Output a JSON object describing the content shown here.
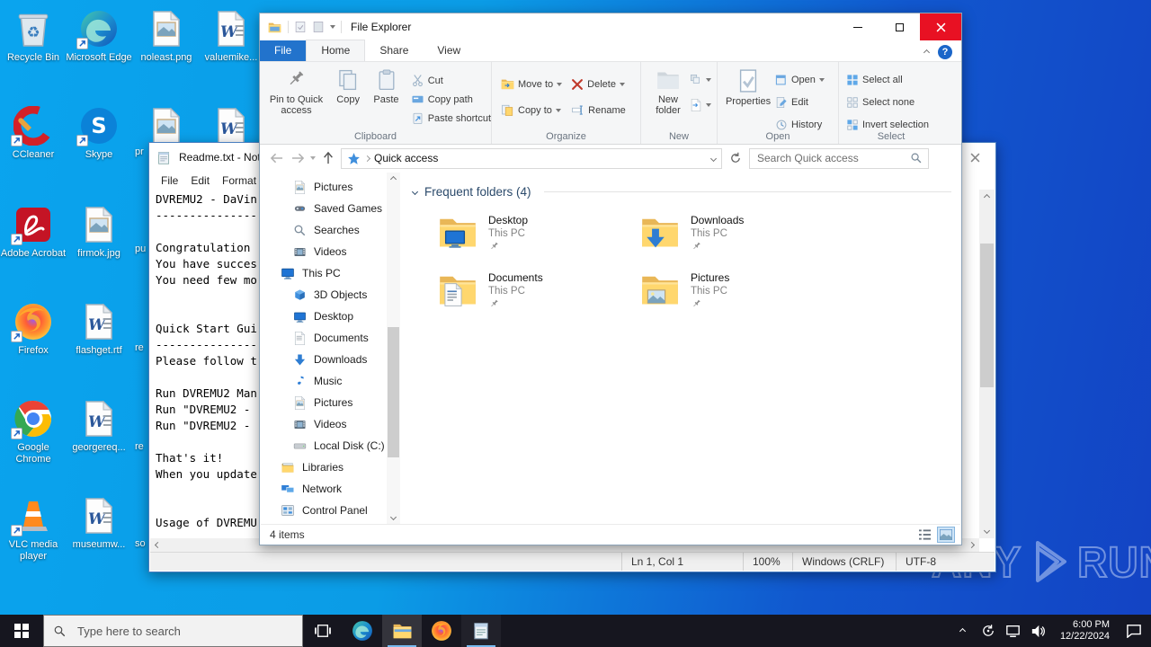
{
  "colors": {
    "accent_blue": "#2273cc",
    "close_button_red": "#e81123",
    "desktop_gradient_left": "#0aa4ee",
    "desktop_gradient_right": "#1343c4",
    "folder_yellow": "#ffd76e",
    "taskbar_bg": "#16161f",
    "taskbar_active_underline": "#76b9ed"
  },
  "desktop": {
    "icons": [
      {
        "label": "Recycle Bin"
      },
      {
        "label": "Microsoft Edge"
      },
      {
        "label": "noleast.png"
      },
      {
        "label": "valuemike..."
      },
      {
        "label": "CCleaner"
      },
      {
        "label": "Skype"
      },
      {
        "label": "pr"
      },
      {
        "label": "Adobe Acrobat"
      },
      {
        "label": "firmok.jpg"
      },
      {
        "label": "pu"
      },
      {
        "label": "Firefox"
      },
      {
        "label": "flashget.rtf"
      },
      {
        "label": "re"
      },
      {
        "label": "Google Chrome"
      },
      {
        "label": "georgereq..."
      },
      {
        "label": "re"
      },
      {
        "label": "VLC media player"
      },
      {
        "label": "museumw..."
      },
      {
        "label": "so"
      }
    ]
  },
  "watermark": {
    "left": "ANY",
    "right": "RUN"
  },
  "notepad": {
    "title": "Readme.txt - Notepad",
    "menu": [
      "File",
      "Edit",
      "Format"
    ],
    "text": "DVREMU2 - DaVin\n----------------\n\nCongratulation\nYou have succes\nYou need few mo\n\n\nQuick Start Gui\n----------------\nPlease follow t\n\nRun DVREMU2 Man\nRun \"DVREMU2 -\nRun \"DVREMU2 -\n\nThat's it!\nWhen you update\n\n\nUsage of DVREMU\n----------------",
    "status": {
      "cursor": "Ln 1, Col 1",
      "zoom": "100%",
      "line_ending": "Windows (CRLF)",
      "encoding": "UTF-8"
    }
  },
  "explorer": {
    "window_title": "File Explorer",
    "tabs": {
      "file": "File",
      "home": "Home",
      "share": "Share",
      "view": "View"
    },
    "ribbon": {
      "pin_to_quick_access": "Pin to Quick access",
      "copy": "Copy",
      "paste": "Paste",
      "cut": "Cut",
      "copy_path": "Copy path",
      "paste_shortcut": "Paste shortcut",
      "group_clipboard": "Clipboard",
      "move_to": "Move to",
      "copy_to": "Copy to",
      "delete": "Delete",
      "rename": "Rename",
      "group_organize": "Organize",
      "new_folder": "New folder",
      "group_new": "New",
      "properties": "Properties",
      "open": "Open",
      "edit": "Edit",
      "history": "History",
      "group_open": "Open",
      "select_all": "Select all",
      "select_none": "Select none",
      "invert_selection": "Invert selection",
      "group_select": "Select"
    },
    "address": {
      "location": "Quick access",
      "search_placeholder": "Search Quick access"
    },
    "nav": [
      {
        "label": "Pictures"
      },
      {
        "label": "Saved Games"
      },
      {
        "label": "Searches"
      },
      {
        "label": "Videos"
      },
      {
        "label": "This PC"
      },
      {
        "label": "3D Objects"
      },
      {
        "label": "Desktop"
      },
      {
        "label": "Documents"
      },
      {
        "label": "Downloads"
      },
      {
        "label": "Music"
      },
      {
        "label": "Pictures"
      },
      {
        "label": "Videos"
      },
      {
        "label": "Local Disk (C:)"
      },
      {
        "label": "Libraries"
      },
      {
        "label": "Network"
      },
      {
        "label": "Control Panel"
      }
    ],
    "content": {
      "section": "Frequent folders (4)",
      "folders": [
        {
          "name": "Desktop",
          "location": "This PC"
        },
        {
          "name": "Downloads",
          "location": "This PC"
        },
        {
          "name": "Documents",
          "location": "This PC"
        },
        {
          "name": "Pictures",
          "location": "This PC"
        }
      ]
    },
    "status_items": "4 items"
  },
  "taskbar": {
    "search_placeholder": "Type here to search",
    "time": "6:00 PM",
    "date": "12/22/2024"
  }
}
